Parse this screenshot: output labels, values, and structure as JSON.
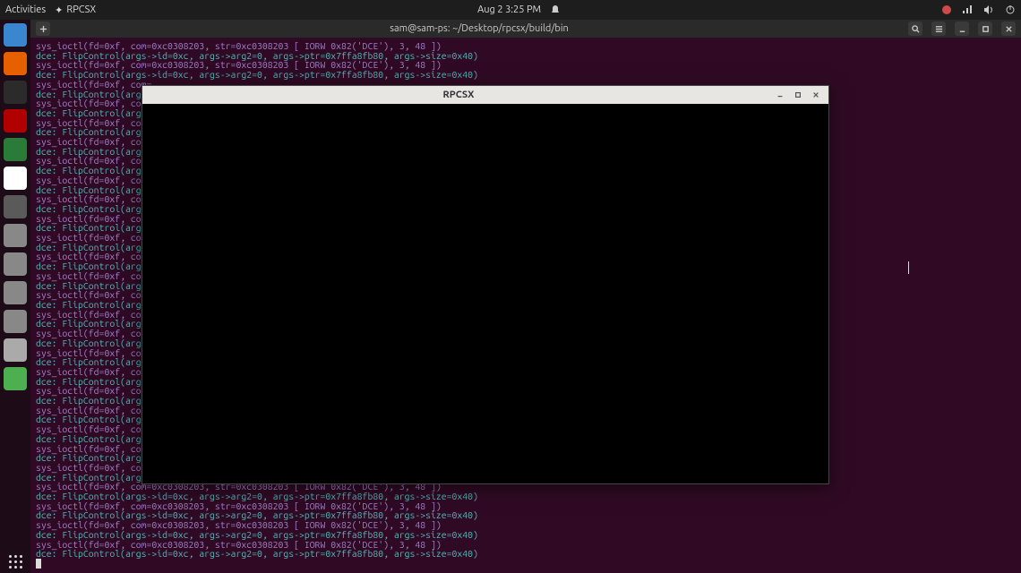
{
  "panel": {
    "activities": "Activities",
    "app_name": "RPCSX",
    "clock": "Aug 2  3:25 PM"
  },
  "terminal": {
    "title": "sam@sam-ps: ~/Desktop/rpcsx/build/bin",
    "lines": [
      {
        "cls": "sys",
        "text": "sys_ioctl(fd=0xf, com=0xc0308203, str=0xc0308203 [ IORW 0x82('DCE'), 3, 48 ])"
      },
      {
        "cls": "dce",
        "text": "dce: FlipControl(args->id=0xc, args->arg2=0, args->ptr=0x7ffa8fb80, args->size=0x40)"
      },
      {
        "cls": "sys",
        "text": "sys_ioctl(fd=0xf, com=0xc0308203, str=0xc0308203 [ IORW 0x82('DCE'), 3, 48 ])"
      },
      {
        "cls": "dce",
        "text": "dce: FlipControl(args->id=0xc, args->arg2=0, args->ptr=0x7ffa8fb80, args->size=0x40)"
      },
      {
        "cls": "sys",
        "text": "sys_ioctl(fd=0xf, com=…"
      },
      {
        "cls": "dce",
        "text": "dce: FlipControl(args…"
      },
      {
        "cls": "sys",
        "text": "sys_ioctl(fd=0xf, com=…"
      },
      {
        "cls": "dce",
        "text": "dce: FlipControl(args…"
      },
      {
        "cls": "sys",
        "text": "sys_ioctl(fd=0xf, com=…"
      },
      {
        "cls": "dce",
        "text": "dce: FlipControl(args…"
      },
      {
        "cls": "sys",
        "text": "sys_ioctl(fd=0xf, com=…"
      },
      {
        "cls": "dce",
        "text": "dce: FlipControl(args…"
      },
      {
        "cls": "sys",
        "text": "sys_ioctl(fd=0xf, com=…"
      },
      {
        "cls": "dce",
        "text": "dce: FlipControl(args…"
      },
      {
        "cls": "sys",
        "text": "sys_ioctl(fd=0xf, com=…"
      },
      {
        "cls": "dce",
        "text": "dce: FlipControl(args…"
      },
      {
        "cls": "sys",
        "text": "sys_ioctl(fd=0xf, com=…"
      },
      {
        "cls": "dce",
        "text": "dce: FlipControl(args…"
      },
      {
        "cls": "sys",
        "text": "sys_ioctl(fd=0xf, com=…"
      },
      {
        "cls": "dce",
        "text": "dce: FlipControl(args…"
      },
      {
        "cls": "sys",
        "text": "sys_ioctl(fd=0xf, com=…"
      },
      {
        "cls": "dce",
        "text": "dce: FlipControl(args…"
      },
      {
        "cls": "sys",
        "text": "sys_ioctl(fd=0xf, com=…"
      },
      {
        "cls": "dce",
        "text": "dce: FlipControl(args…"
      },
      {
        "cls": "sys",
        "text": "sys_ioctl(fd=0xf, com=…"
      },
      {
        "cls": "dce",
        "text": "dce: FlipControl(args…"
      },
      {
        "cls": "sys",
        "text": "sys_ioctl(fd=0xf, com=…"
      },
      {
        "cls": "dce",
        "text": "dce: FlipControl(args…"
      },
      {
        "cls": "sys",
        "text": "sys_ioctl(fd=0xf, com=…"
      },
      {
        "cls": "dce",
        "text": "dce: FlipControl(args…"
      },
      {
        "cls": "sys",
        "text": "sys_ioctl(fd=0xf, com=…"
      },
      {
        "cls": "dce",
        "text": "dce: FlipControl(args…"
      },
      {
        "cls": "sys",
        "text": "sys_ioctl(fd=0xf, com=…"
      },
      {
        "cls": "dce",
        "text": "dce: FlipControl(args…"
      },
      {
        "cls": "sys",
        "text": "sys_ioctl(fd=0xf, com=…"
      },
      {
        "cls": "dce",
        "text": "dce: FlipControl(args…"
      },
      {
        "cls": "sys",
        "text": "sys_ioctl(fd=0xf, com=…"
      },
      {
        "cls": "dce",
        "text": "dce: FlipControl(args…"
      },
      {
        "cls": "sys",
        "text": "sys_ioctl(fd=0xf, com=…"
      },
      {
        "cls": "dce",
        "text": "dce: FlipControl(args…"
      },
      {
        "cls": "sys",
        "text": "sys_ioctl(fd=0xf, com=…"
      },
      {
        "cls": "dce",
        "text": "dce: FlipControl(args…"
      },
      {
        "cls": "sys",
        "text": "sys_ioctl(fd=0xf, com=…"
      },
      {
        "cls": "dce",
        "text": "dce: FlipControl(args…"
      },
      {
        "cls": "sys",
        "text": "sys_ioctl(fd=0xf, com=…"
      },
      {
        "cls": "dce",
        "text": "dce: FlipControl(args…"
      },
      {
        "cls": "sys",
        "text": "sys_ioctl(fd=0xf, com=0xc0308203, str=0xc0308203 [ IORW 0x82('DCE'), 3, 48 ])"
      },
      {
        "cls": "dce",
        "text": "dce: FlipControl(args->id=0xc, args->arg2=0, args->ptr=0x7ffa8fb80, args->size=0x40)"
      },
      {
        "cls": "sys",
        "text": "sys_ioctl(fd=0xf, com=0xc0308203, str=0xc0308203 [ IORW 0x82('DCE'), 3, 48 ])"
      },
      {
        "cls": "dce",
        "text": "dce: FlipControl(args->id=0xc, args->arg2=0, args->ptr=0x7ffa8fb80, args->size=0x40)"
      },
      {
        "cls": "sys",
        "text": "sys_ioctl(fd=0xf, com=0xc0308203, str=0xc0308203 [ IORW 0x82('DCE'), 3, 48 ])"
      },
      {
        "cls": "dce",
        "text": "dce: FlipControl(args->id=0xc, args->arg2=0, args->ptr=0x7ffa8fb80, args->size=0x40)"
      },
      {
        "cls": "sys",
        "text": "sys_ioctl(fd=0xf, com=0xc0308203, str=0xc0308203 [ IORW 0x82('DCE'), 3, 48 ])"
      },
      {
        "cls": "dce",
        "text": "dce: FlipControl(args->id=0xc, args->arg2=0, args->ptr=0x7ffa8fb80, args->size=0x40)"
      }
    ]
  },
  "child": {
    "title": "RPCSX"
  },
  "dock_items": [
    {
      "name": "files-icon",
      "bg": "#3a87d0"
    },
    {
      "name": "firefox-icon",
      "bg": "#e66000"
    },
    {
      "name": "terminal-icon",
      "bg": "#2b2b2b"
    },
    {
      "name": "filezilla-icon",
      "bg": "#b00000"
    },
    {
      "name": "browser-icon",
      "bg": "#2a7a3a"
    },
    {
      "name": "text-editor-icon",
      "bg": "#ffffff"
    },
    {
      "name": "settings-icon",
      "bg": "#5a5a5a"
    },
    {
      "name": "disk-icon",
      "bg": "#888"
    },
    {
      "name": "disk2-icon",
      "bg": "#888"
    },
    {
      "name": "disk3-icon",
      "bg": "#888"
    },
    {
      "name": "disk4-icon",
      "bg": "#888"
    },
    {
      "name": "ssd-icon",
      "bg": "#aaa"
    },
    {
      "name": "trash-icon",
      "bg": "#4caf50"
    }
  ]
}
